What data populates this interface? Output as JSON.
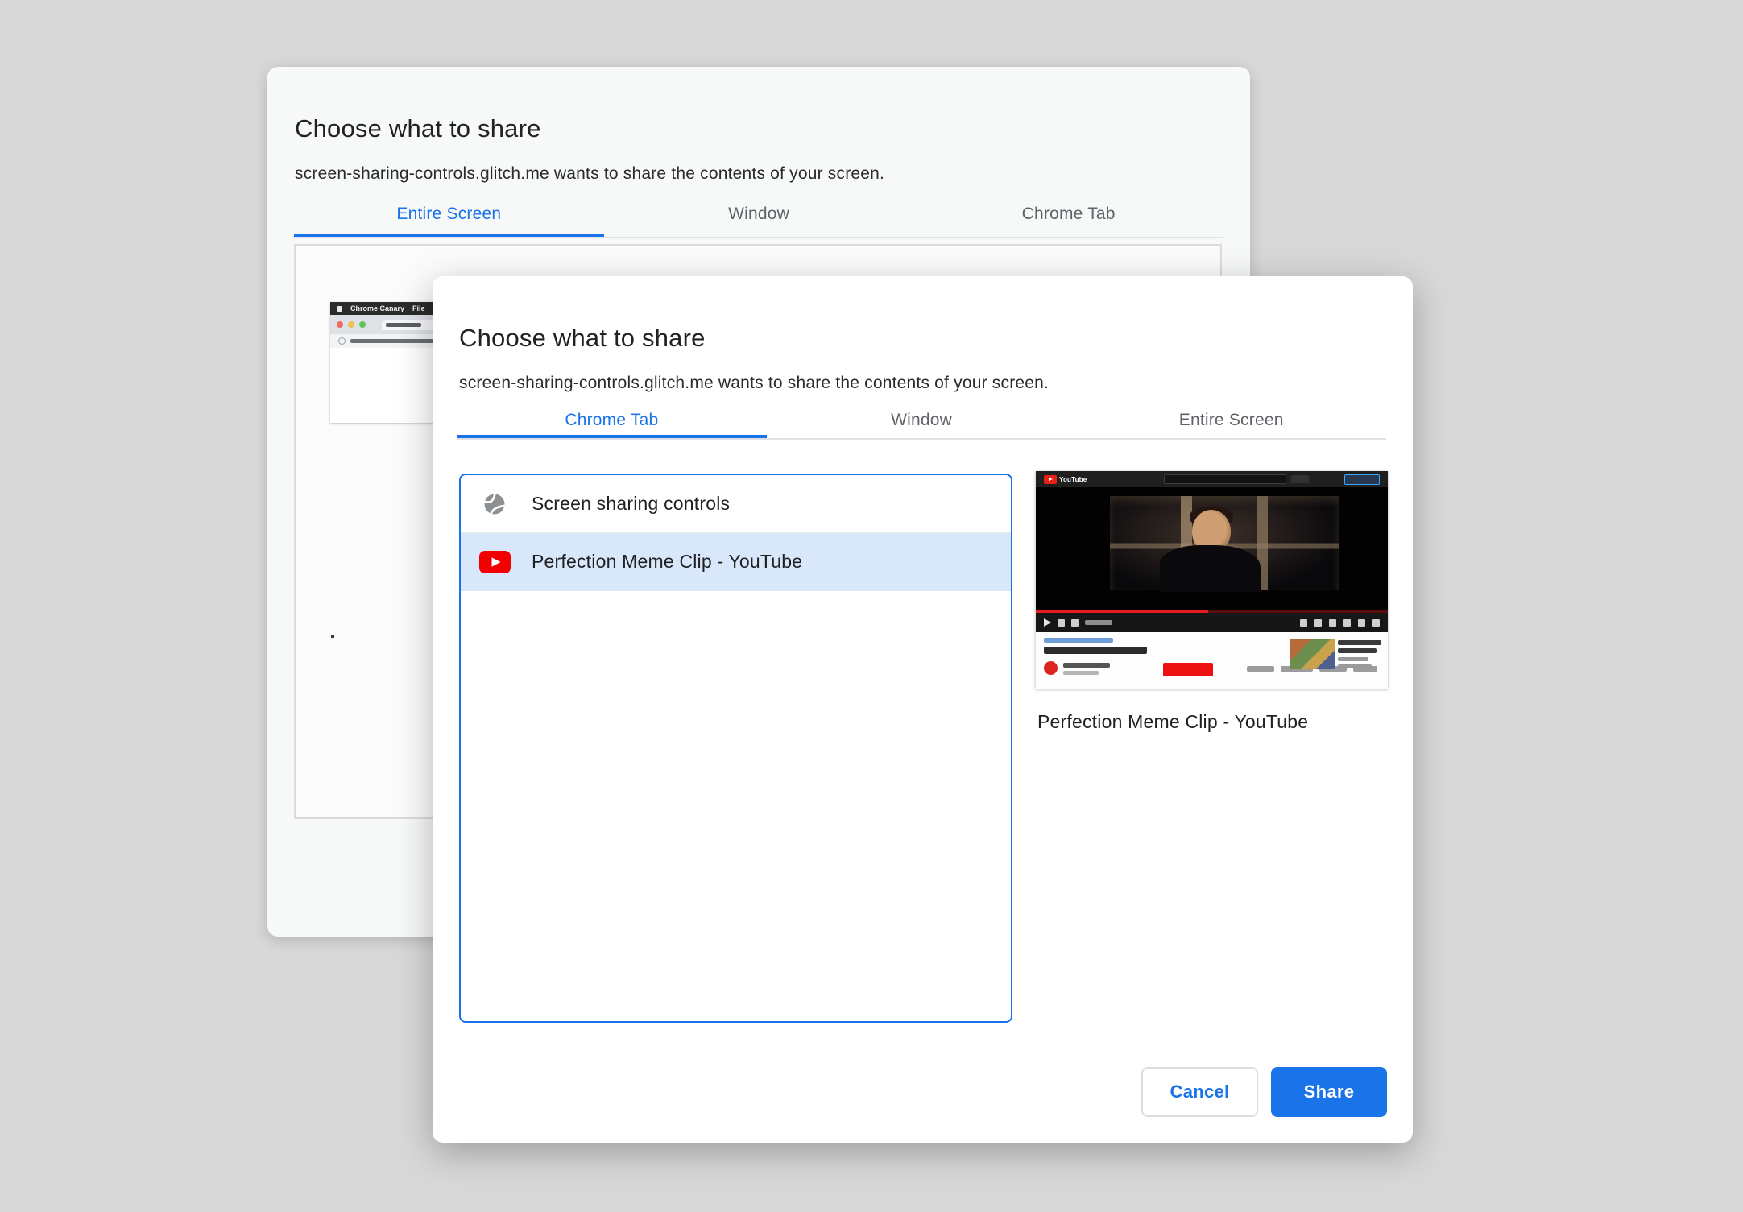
{
  "colors": {
    "accent_blue": "#1a73e8",
    "selected_row_bg": "#d9e7fb",
    "youtube_red": "#e62117",
    "page_background": "#d8d8d8"
  },
  "back_dialog": {
    "title": "Choose what to share",
    "subtitle": "screen-sharing-controls.glitch.me wants to share the contents of your screen.",
    "tabs": [
      {
        "label": "Entire Screen",
        "active": true
      },
      {
        "label": "Window",
        "active": false
      },
      {
        "label": "Chrome Tab",
        "active": false
      }
    ],
    "mini_screenshot": {
      "menubar_app": "Chrome Canary",
      "menubar_item": "File"
    }
  },
  "front_dialog": {
    "title": "Choose what to share",
    "subtitle": "screen-sharing-controls.glitch.me wants to share the contents of your screen.",
    "tabs": [
      {
        "label": "Chrome Tab",
        "active": true
      },
      {
        "label": "Window",
        "active": false
      },
      {
        "label": "Entire Screen",
        "active": false
      }
    ],
    "tab_list": [
      {
        "title": "Screen sharing controls",
        "icon": "globe-icon",
        "selected": false
      },
      {
        "title": "Perfection Meme Clip - YouTube",
        "icon": "youtube-icon",
        "selected": true
      }
    ],
    "preview": {
      "logo_text": "YouTube",
      "caption": "Perfection Meme Clip - YouTube"
    },
    "buttons": {
      "cancel": "Cancel",
      "share": "Share"
    }
  }
}
